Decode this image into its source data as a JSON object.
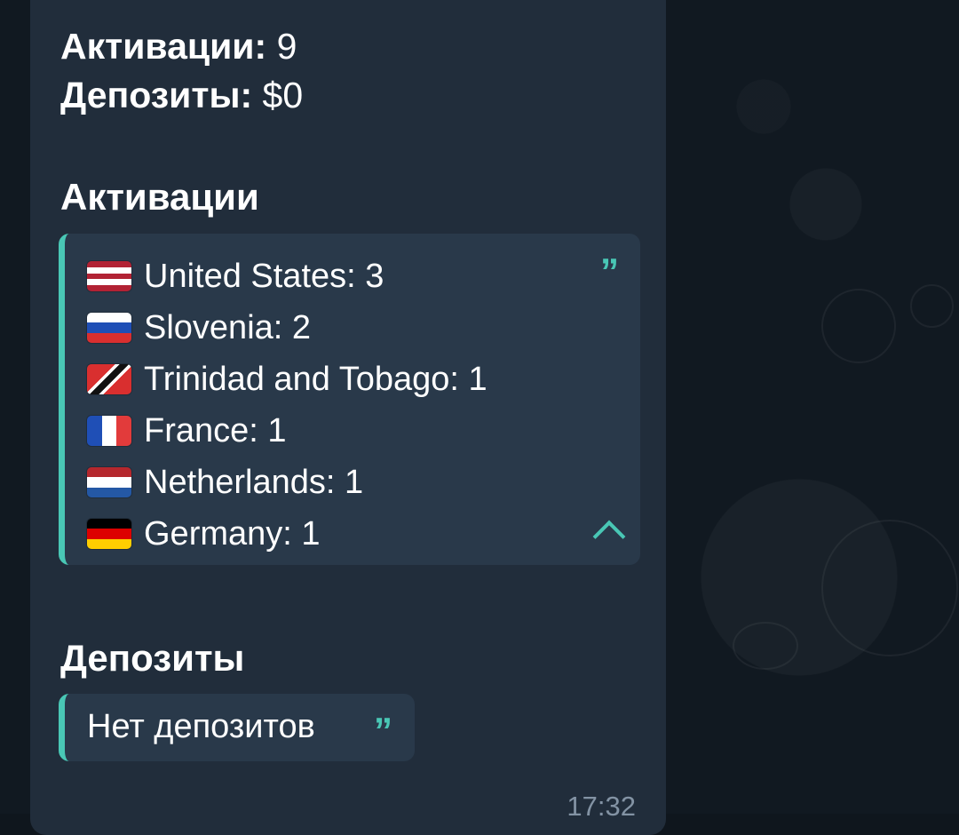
{
  "summary": {
    "activations_label": "Активации:",
    "activations_value": "9",
    "deposits_label": "Депозиты:",
    "deposits_value": "$0"
  },
  "activations_section": {
    "title": "Активации",
    "quote_icon": "quote-icon",
    "collapse_icon": "chevron-up-icon",
    "items": [
      {
        "flag": "us-flag-icon",
        "text": "United States: 3"
      },
      {
        "flag": "si-flag-icon",
        "text": "Slovenia: 2"
      },
      {
        "flag": "tt-flag-icon",
        "text": "Trinidad and Tobago: 1"
      },
      {
        "flag": "fr-flag-icon",
        "text": "France: 1"
      },
      {
        "flag": "nl-flag-icon",
        "text": "Netherlands: 1"
      },
      {
        "flag": "de-flag-icon",
        "text": "Germany: 1"
      }
    ]
  },
  "deposits_section": {
    "title": "Депозиты",
    "text": "Нет депозитов",
    "quote_icon": "quote-icon"
  },
  "message_time": "17:32",
  "colors": {
    "bubble": "#212d3b",
    "quote_bg": "#29394a",
    "accent": "#49c7b5",
    "text": "#ffffff",
    "time": "#8393a4"
  }
}
